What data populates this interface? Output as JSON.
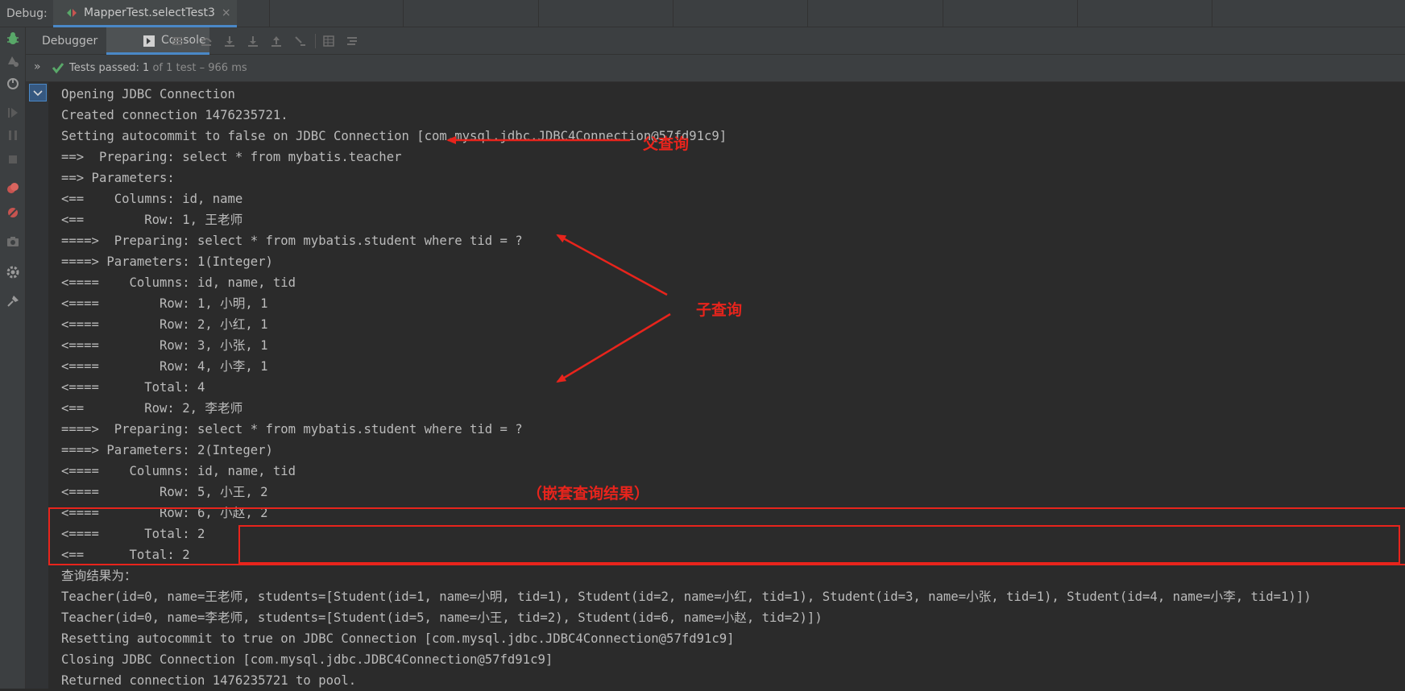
{
  "window": {
    "debug_label": "Debug:",
    "tab_title": "MapperTest.selectTest3",
    "tab_close": "×"
  },
  "toolbar": {
    "debugger_tab": "Debugger",
    "console_tab": "Console",
    "icons": [
      "menu-icon",
      "step-over-icon",
      "step-into-icon",
      "force-step-into-icon",
      "step-out-icon",
      "run-to-cursor-icon",
      "evaluate-icon",
      "trace-icon"
    ]
  },
  "status": {
    "expand": "»",
    "passed_label": "Tests passed: ",
    "passed_count": "1",
    "passed_rest": " of 1 test – 966 ms"
  },
  "console_lines": [
    "Opening JDBC Connection",
    "Created connection 1476235721.",
    "Setting autocommit to false on JDBC Connection [com.mysql.jdbc.JDBC4Connection@57fd91c9]",
    "==>  Preparing: select * from mybatis.teacher",
    "==> Parameters: ",
    "<==    Columns: id, name",
    "<==        Row: 1, 王老师",
    "====>  Preparing: select * from mybatis.student where tid = ?",
    "====> Parameters: 1(Integer)",
    "<====    Columns: id, name, tid",
    "<====        Row: 1, 小明, 1",
    "<====        Row: 2, 小红, 1",
    "<====        Row: 3, 小张, 1",
    "<====        Row: 4, 小李, 1",
    "<====      Total: 4",
    "<==        Row: 2, 李老师",
    "====>  Preparing: select * from mybatis.student where tid = ?",
    "====> Parameters: 2(Integer)",
    "<====    Columns: id, name, tid",
    "<====        Row: 5, 小王, 2",
    "<====        Row: 6, 小赵, 2",
    "<====      Total: 2",
    "<==      Total: 2",
    "查询结果为：",
    "Teacher(id=0, name=王老师, students=[Student(id=1, name=小明, tid=1), Student(id=2, name=小红, tid=1), Student(id=3, name=小张, tid=1), Student(id=4, name=小李, tid=1)])",
    "Teacher(id=0, name=李老师, students=[Student(id=5, name=小王, tid=2), Student(id=6, name=小赵, tid=2)])",
    "Resetting autocommit to true on JDBC Connection [com.mysql.jdbc.JDBC4Connection@57fd91c9]",
    "Closing JDBC Connection [com.mysql.jdbc.JDBC4Connection@57fd91c9]",
    "Returned connection 1476235721 to pool."
  ],
  "annotations": {
    "parent_query": "父查询",
    "sub_query": "子查询",
    "nested_result": "（嵌套查询结果）"
  },
  "colors": {
    "annotation_red": "#e8241c",
    "accent_blue": "#4a88c7",
    "pass_green": "#59a869"
  }
}
